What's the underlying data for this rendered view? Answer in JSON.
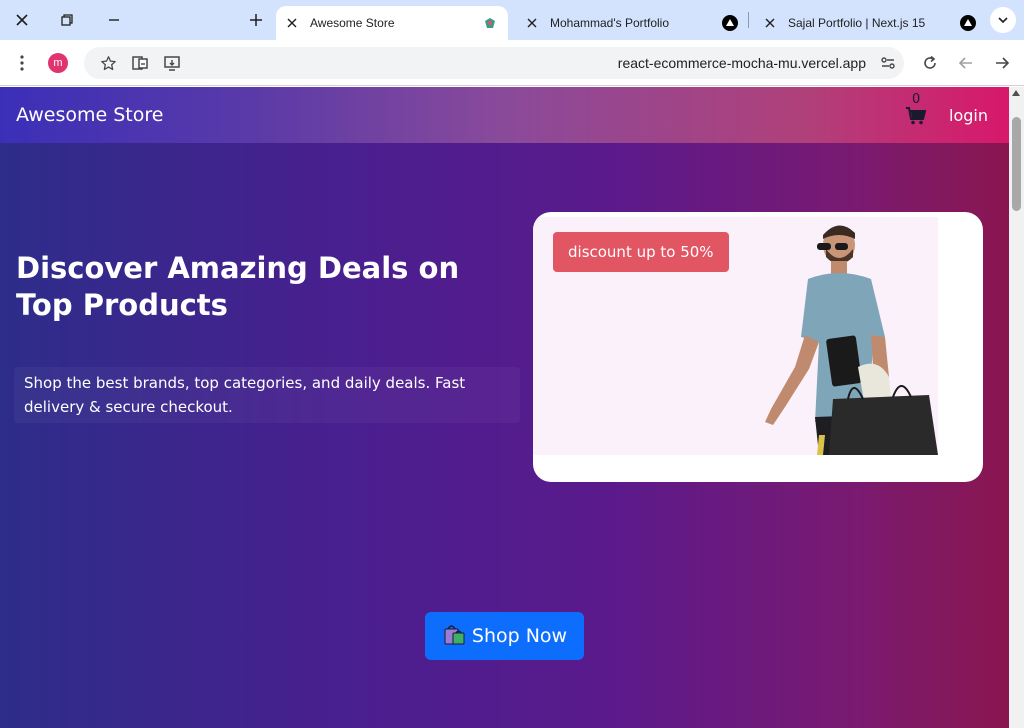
{
  "browser": {
    "tabs": [
      {
        "title": "Awesome Store",
        "active": true
      },
      {
        "title": "Mohammad's Portfolio",
        "active": false
      },
      {
        "title": "Sajal Portfolio | Next.js 15",
        "active": false
      }
    ],
    "profile_initial": "m",
    "url": "react-ecommerce-mocha-mu.vercel.app"
  },
  "site": {
    "brand": "Awesome Store",
    "cart_count": "0",
    "login_label": "login",
    "hero": {
      "headline": "Discover Amazing Deals on Top Products",
      "subtext": "Shop the best brands, top categories, and daily deals. Fast delivery & secure checkout.",
      "badge": "discount up to 50%",
      "cta_label": "Shop Now"
    }
  },
  "icons": {
    "cta": "shopping-bags-icon",
    "cart": "cart-icon"
  },
  "colors": {
    "tabstrip": "#d3e3fd",
    "discount_badge": "#e25563",
    "cta_button": "#0d6efd",
    "navbar_end": "#d8186a"
  }
}
